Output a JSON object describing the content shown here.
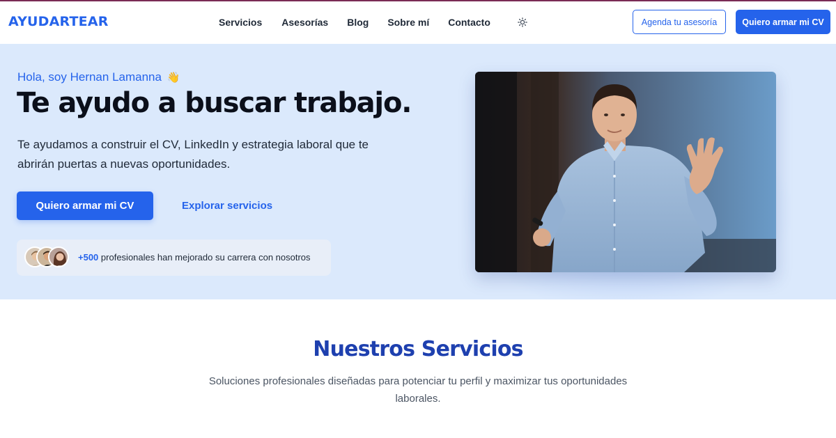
{
  "brand": {
    "name": "AYUDARTEAR",
    "accent": "#2563eb",
    "topline": "#7a2b55"
  },
  "nav": {
    "items": [
      {
        "label": "Servicios"
      },
      {
        "label": "Asesorías"
      },
      {
        "label": "Blog"
      },
      {
        "label": "Sobre mí"
      },
      {
        "label": "Contacto"
      }
    ],
    "theme_icon": "sun-icon",
    "cta_secondary": "Agenda tu asesoría",
    "cta_primary": "Quiero armar mi CV"
  },
  "hero": {
    "greeting": "Hola, soy Hernan Lamanna",
    "greeting_emoji": "👋",
    "headline": "Te ayudo a buscar trabajo.",
    "subtitle": "Te ayudamos a construir el CV, LinkedIn y estrategia laboral que te abrirán puertas a nuevas oportunidades.",
    "primary_button": "Quiero armar mi CV",
    "secondary_link": "Explorar servicios",
    "social_proof": {
      "count": "+500",
      "text": "profesionales han mejorado su carrera con nosotros"
    },
    "background": "#dbe9fc"
  },
  "services": {
    "title": "Nuestros Servicios",
    "subtitle": "Soluciones profesionales diseñadas para potenciar tu perfil y maximizar tus oportunidades laborales."
  }
}
